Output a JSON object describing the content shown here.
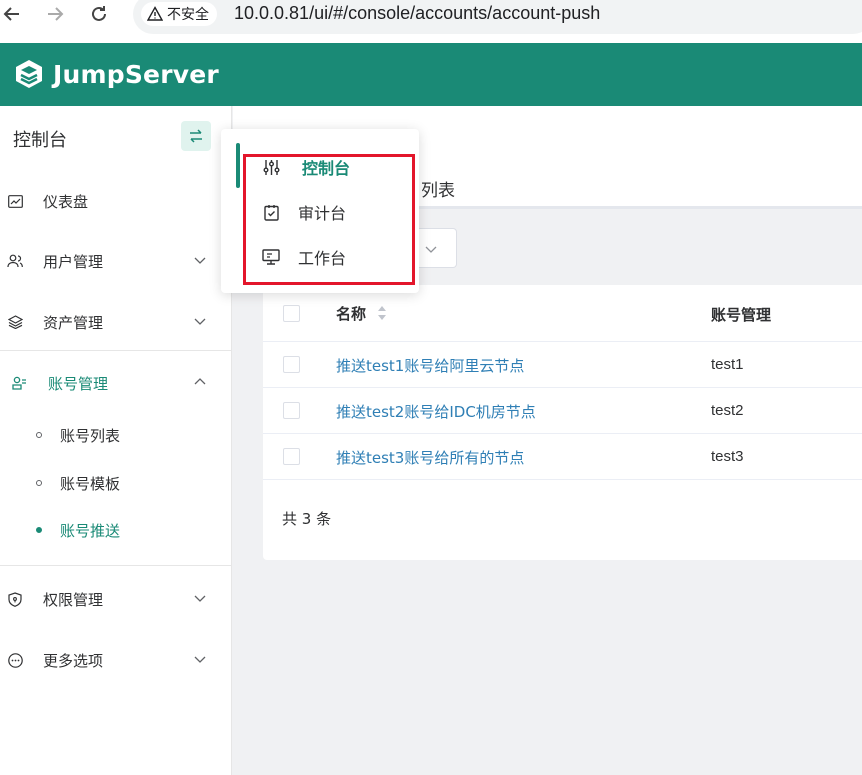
{
  "browser": {
    "security_label": "不安全",
    "url": "10.0.0.81/ui/#/console/accounts/account-push"
  },
  "header": {
    "logo_text": "JumpServer"
  },
  "sidebar": {
    "title": "控制台",
    "items": [
      {
        "label": "仪表盘",
        "icon": "dashboard-icon"
      },
      {
        "label": "用户管理",
        "icon": "users-icon"
      },
      {
        "label": "资产管理",
        "icon": "layers-icon"
      },
      {
        "label": "账号管理",
        "icon": "account-icon"
      },
      {
        "label": "权限管理",
        "icon": "shield-icon"
      },
      {
        "label": "更多选项",
        "icon": "more-icon"
      }
    ],
    "sub_items": [
      {
        "label": "账号列表"
      },
      {
        "label": "账号模板"
      },
      {
        "label": "账号推送"
      }
    ]
  },
  "main": {
    "tab_label": "列表",
    "partial_text": "‥",
    "table": {
      "columns": [
        "名称",
        "账号管理"
      ],
      "rows": [
        {
          "name": "推送test1账号给阿里云节点",
          "account": "test1"
        },
        {
          "name": "推送test2账号给IDC机房节点",
          "account": "test2"
        },
        {
          "name": "推送test3账号给所有的节点",
          "account": "test3"
        }
      ],
      "total": "共 3 条"
    }
  },
  "popover": {
    "items": [
      {
        "label": "控制台",
        "icon": "sliders-icon"
      },
      {
        "label": "审计台",
        "icon": "clipboard-check-icon"
      },
      {
        "label": "工作台",
        "icon": "monitor-icon"
      }
    ]
  },
  "colors": {
    "brand": "#1a8a76",
    "link": "#2f7fb5",
    "highlight": "#e3162b"
  }
}
